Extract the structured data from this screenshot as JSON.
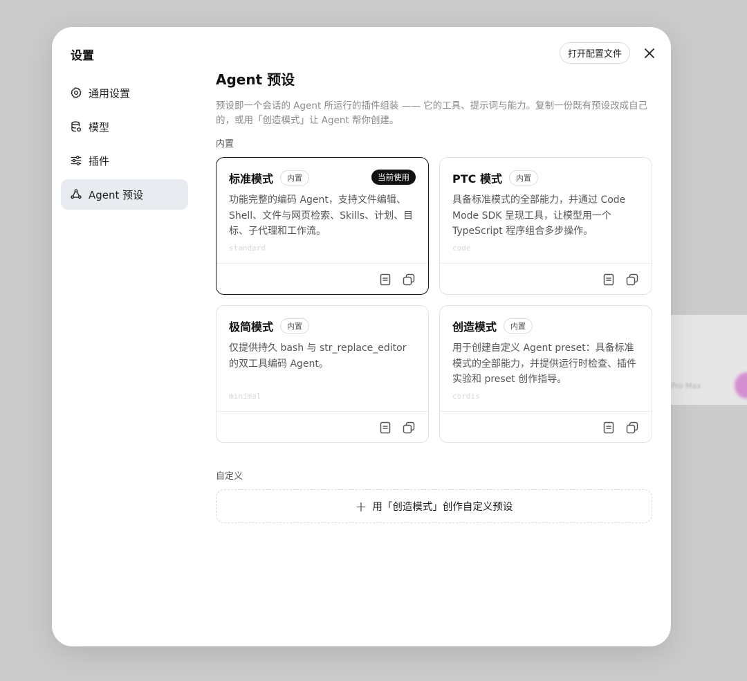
{
  "modal": {
    "title": "设置",
    "open_config_label": "打开配置文件"
  },
  "nav": {
    "items": [
      {
        "label": "通用设置",
        "icon": "gear-icon"
      },
      {
        "label": "模型",
        "icon": "database-icon"
      },
      {
        "label": "插件",
        "icon": "sliders-icon"
      },
      {
        "label": "Agent 预设",
        "icon": "agent-icon",
        "active": true
      }
    ]
  },
  "page": {
    "title": "Agent 预设",
    "description": "预设即一个会话的 Agent 所运行的插件组装 —— 它的工具、提示词与能力。复制一份既有预设改成自己的，或用「创造模式」让 Agent 帮你创建。",
    "builtin_label": "内置",
    "custom_label": "自定义",
    "create_label": "用「创造模式」创作自定义预设"
  },
  "cards": [
    {
      "name": "标准模式",
      "badge": "内置",
      "current": "当前使用",
      "description": "功能完整的编码 Agent，支持文件编辑、Shell、文件与网页检索、Skills、计划、目标、子代理和工作流。",
      "id": "standard"
    },
    {
      "name": "PTC 模式",
      "badge": "内置",
      "description": "具备标准模式的全部能力，并通过 Code Mode SDK 呈现工具，让模型用一个 TypeScript 程序组合多步操作。",
      "id": "code"
    },
    {
      "name": "极简模式",
      "badge": "内置",
      "description": "仅提供持久 bash 与 str_replace_editor 的双工具编码 Agent。",
      "id": "minimal"
    },
    {
      "name": "创造模式",
      "badge": "内置",
      "description": "用于创建自定义 Agent preset：具备标准模式的全部能力，并提供运行时检查、插件实验和 preset 创作指导。",
      "id": "cordis"
    }
  ],
  "background": {
    "hint_text": "Pro Max"
  }
}
